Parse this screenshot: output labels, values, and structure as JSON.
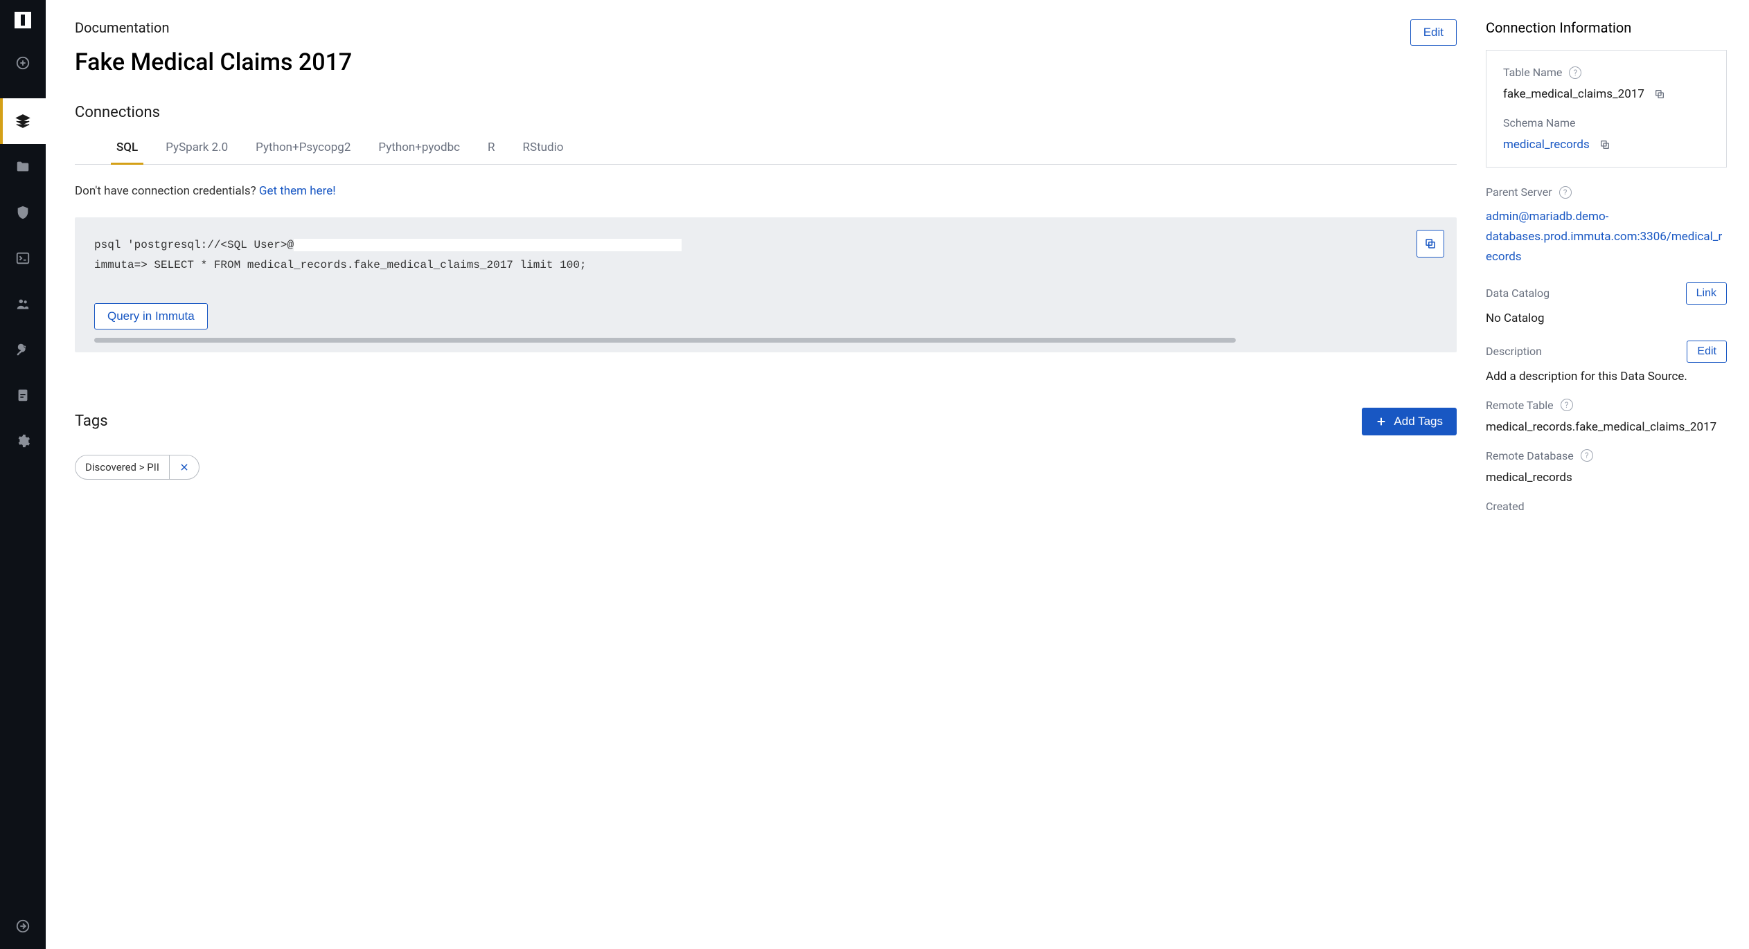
{
  "header": {
    "documentation_label": "Documentation",
    "title": "Fake Medical Claims 2017",
    "edit_label": "Edit"
  },
  "connections": {
    "title": "Connections",
    "tabs": [
      "SQL",
      "PySpark 2.0",
      "Python+Psycopg2",
      "Python+pyodbc",
      "R",
      "RStudio"
    ],
    "active_tab_index": 0,
    "credentials_prompt": "Don't have connection credentials? ",
    "credentials_link": "Get them here!",
    "code_line1a": "psql 'postgresql://<SQL User>@",
    "code_line2": "immuta=> SELECT * FROM medical_records.fake_medical_claims_2017 limit 100;",
    "query_button": "Query in Immuta"
  },
  "tags": {
    "title": "Tags",
    "add_button": "Add Tags",
    "items": [
      {
        "label": "Discovered > PII"
      }
    ]
  },
  "connection_info": {
    "title": "Connection Information",
    "table_name_label": "Table Name",
    "table_name": "fake_medical_claims_2017",
    "schema_name_label": "Schema Name",
    "schema_name": "medical_records",
    "parent_server_label": "Parent Server",
    "parent_server": "admin@mariadb.demo-databases.prod.immuta.com:3306/medical_records",
    "data_catalog_label": "Data Catalog",
    "data_catalog_value": "No Catalog",
    "link_button": "Link",
    "description_label": "Description",
    "description_value": "Add a description for this Data Source.",
    "edit_button": "Edit",
    "remote_table_label": "Remote Table",
    "remote_table": "medical_records.fake_medical_claims_2017",
    "remote_database_label": "Remote Database",
    "remote_database": "medical_records",
    "created_label": "Created"
  }
}
